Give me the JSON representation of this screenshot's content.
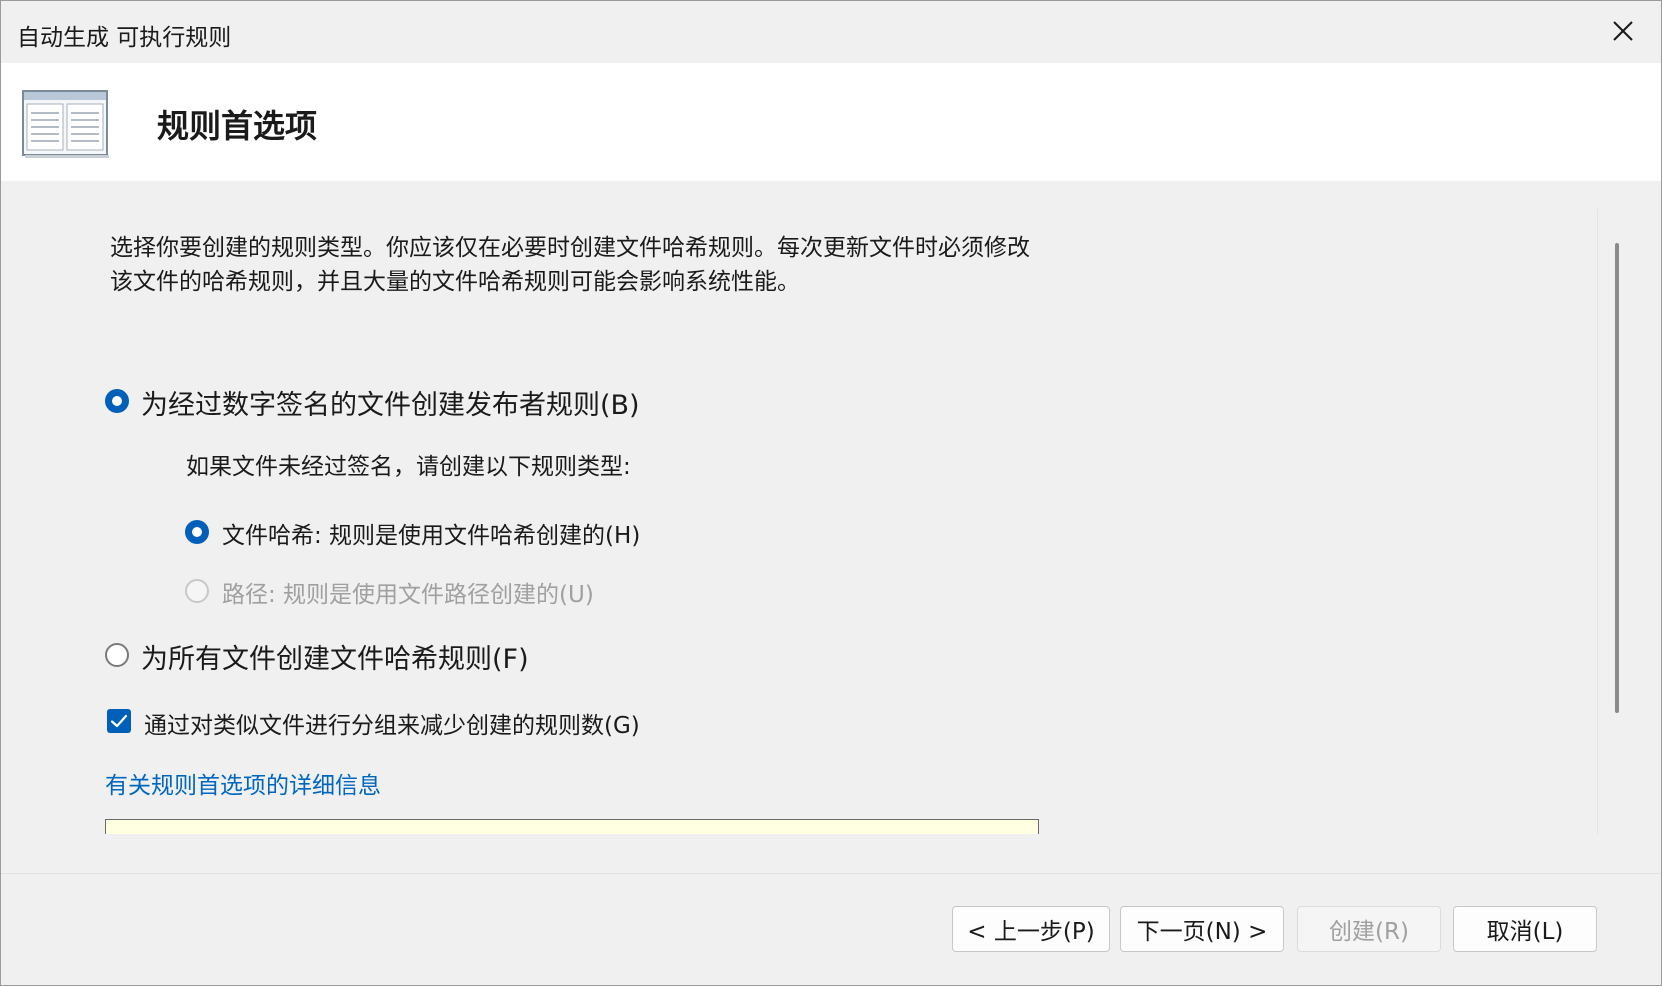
{
  "window": {
    "title": "自动生成 可执行规则"
  },
  "header": {
    "title": "规则首选项",
    "icon": "window-list-icon"
  },
  "description": "选择你要创建的规则类型。你应该仅在必要时创建文件哈希规则。每次更新文件时必须修改该文件的哈希规则，并且大量的文件哈希规则可能会影响系统性能。",
  "options": {
    "publisher_rule": {
      "label": "为经过数字签名的文件创建发布者规则(B)",
      "checked": true
    },
    "unsigned_heading": "如果文件未经过签名，请创建以下规则类型:",
    "file_hash": {
      "label": "文件哈希: 规则是使用文件哈希创建的(H)",
      "checked": true
    },
    "path": {
      "label": "路径: 规则是使用文件路径创建的(U)",
      "checked": false,
      "disabled": true
    },
    "all_hash_rule": {
      "label": "为所有文件创建文件哈希规则(F)",
      "checked": false
    },
    "group_similar": {
      "label": "通过对类似文件进行分组来减少创建的规则数(G)",
      "checked": true
    }
  },
  "more_info_link": "有关规则首选项的详细信息",
  "buttons": {
    "back": "< 上一步(P)",
    "next": "下一页(N) >",
    "create": "创建(R)",
    "cancel": "取消(L)"
  },
  "colors": {
    "accent": "#005fb8",
    "link": "#0067c0",
    "info_box": "#ffffe1"
  }
}
